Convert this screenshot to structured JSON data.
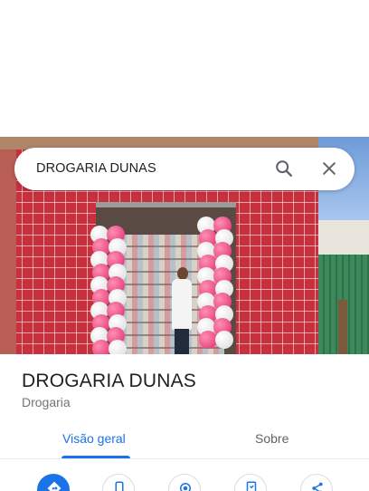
{
  "search": {
    "query": "DROGARIA DUNAS"
  },
  "place": {
    "name": "DROGARIA DUNAS",
    "category": "Drogaria"
  },
  "tabs": [
    {
      "label": "Visão geral",
      "selected": true
    },
    {
      "label": "Sobre",
      "selected": false
    }
  ],
  "actions": [
    {
      "icon": "directions-icon"
    },
    {
      "icon": "phone-icon"
    },
    {
      "icon": "location-icon"
    },
    {
      "icon": "save-icon"
    },
    {
      "icon": "share-icon"
    }
  ],
  "colors": {
    "accent": "#1a73e8",
    "text": "#202124",
    "muted": "#70757a"
  }
}
